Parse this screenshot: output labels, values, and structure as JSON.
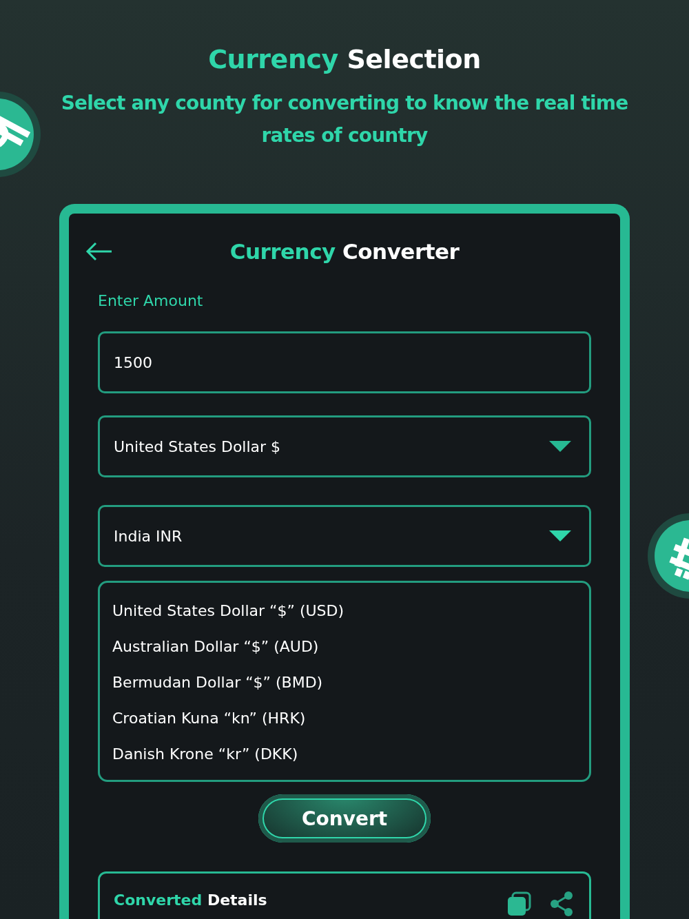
{
  "headline": {
    "accent": "Currency",
    "rest": "Selection"
  },
  "subtitle": "Select any county for converting to know the real time rates of country",
  "app": {
    "title": {
      "accent": "Currency",
      "rest": "Converter"
    },
    "amount_label": "Enter Amount",
    "amount": {
      "value": "1500"
    },
    "from_select": {
      "value": "United States Dollar $",
      "expanded": false
    },
    "to_select": {
      "value": "India INR",
      "expanded": true
    },
    "options": [
      {
        "label": "United States Dollar “$” (USD)"
      },
      {
        "label": "Australian Dollar “$” (AUD)"
      },
      {
        "label": "Bermudan Dollar “$” (BMD)"
      },
      {
        "label": "Croatian Kuna “kn” (HRK)"
      },
      {
        "label": "Danish Krone “kr” (DKK)"
      }
    ],
    "convert_button": "Convert",
    "details": {
      "title": {
        "accent": "Converted",
        "rest": "Details"
      }
    }
  }
}
